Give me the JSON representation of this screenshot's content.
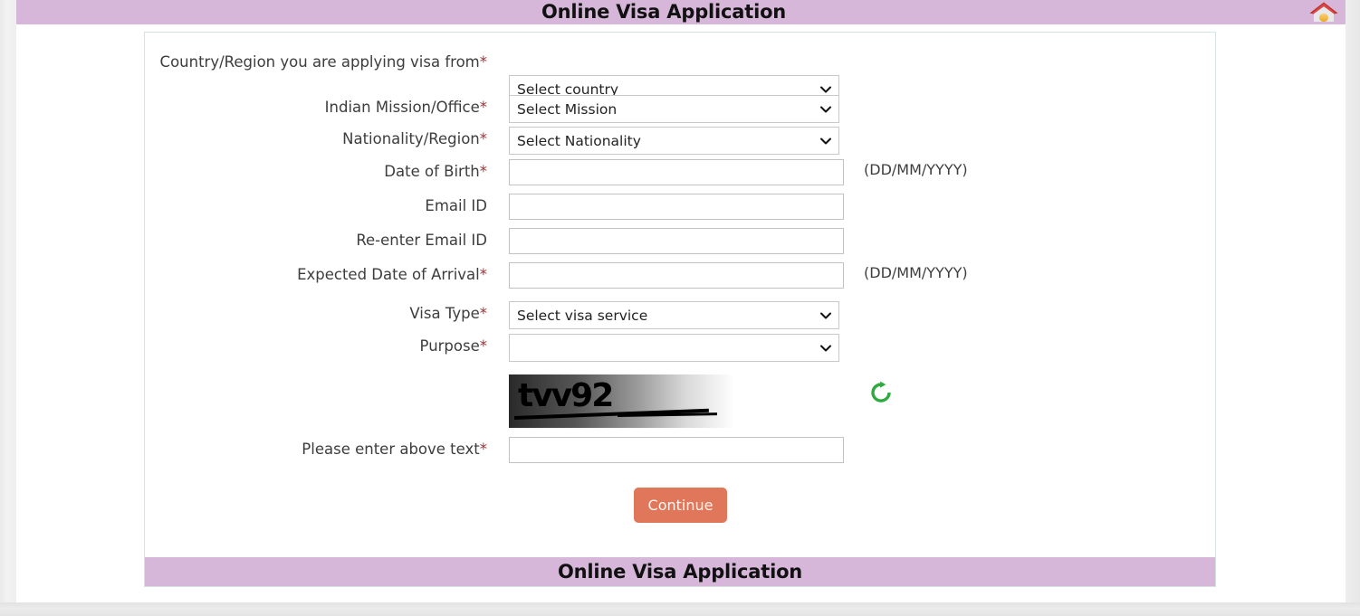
{
  "header": {
    "title": "Online Visa Application",
    "home_icon": "home-icon",
    "banner_color": "#d7b7d9"
  },
  "footer": {
    "title": "Online Visa Application"
  },
  "form": {
    "required_marker": "*",
    "fields": [
      {
        "id": "country-region",
        "label": "Country/Region you are applying visa from",
        "required": true,
        "control": "select",
        "value": "Select country"
      },
      {
        "id": "indian-mission-office",
        "label": "Indian Mission/Office",
        "required": true,
        "control": "select",
        "value": "Select Mission"
      },
      {
        "id": "nationality-region",
        "label": "Nationality/Region",
        "required": true,
        "control": "select",
        "value": "Select Nationality"
      },
      {
        "id": "date-of-birth",
        "label": "Date of Birth",
        "required": true,
        "control": "text",
        "value": "",
        "hint": "(DD/MM/YYYY)"
      },
      {
        "id": "email-id",
        "label": "Email ID",
        "required": false,
        "control": "text",
        "value": ""
      },
      {
        "id": "re-enter-email-id",
        "label": "Re-enter Email ID",
        "required": false,
        "control": "text",
        "value": ""
      },
      {
        "id": "expected-date-of-arrival",
        "label": "Expected Date of Arrival",
        "required": true,
        "control": "text",
        "value": "",
        "hint": "(DD/MM/YYYY)"
      },
      {
        "id": "visa-type",
        "label": "Visa Type",
        "required": true,
        "control": "select",
        "value": "Select visa service"
      },
      {
        "id": "purpose",
        "label": "Purpose",
        "required": true,
        "control": "select",
        "value": ""
      },
      {
        "id": "captcha-answer",
        "label": "Please enter above text",
        "required": true,
        "control": "text",
        "value": ""
      }
    ],
    "captcha": {
      "text": "tvv92",
      "refresh_icon": "refresh-icon"
    },
    "submit": {
      "label": "Continue",
      "color": "#e0775a"
    }
  }
}
